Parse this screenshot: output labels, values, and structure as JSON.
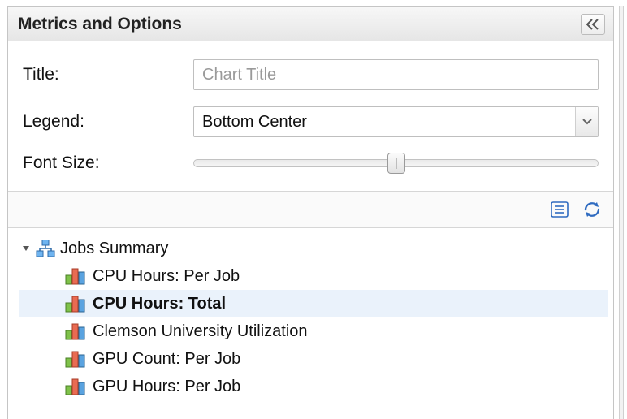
{
  "panel": {
    "title": "Metrics and Options"
  },
  "form": {
    "title_label": "Title:",
    "title_placeholder": "Chart Title",
    "title_value": "",
    "legend_label": "Legend:",
    "legend_value": "Bottom Center",
    "font_size_label": "Font Size:"
  },
  "tree": {
    "root_label": "Jobs Summary",
    "items": [
      {
        "label": "CPU Hours: Per Job",
        "selected": false
      },
      {
        "label": "CPU Hours: Total",
        "selected": true
      },
      {
        "label": "Clemson University Utilization",
        "selected": false
      },
      {
        "label": "GPU Count: Per Job",
        "selected": false
      },
      {
        "label": "GPU Hours: Per Job",
        "selected": false
      }
    ]
  }
}
